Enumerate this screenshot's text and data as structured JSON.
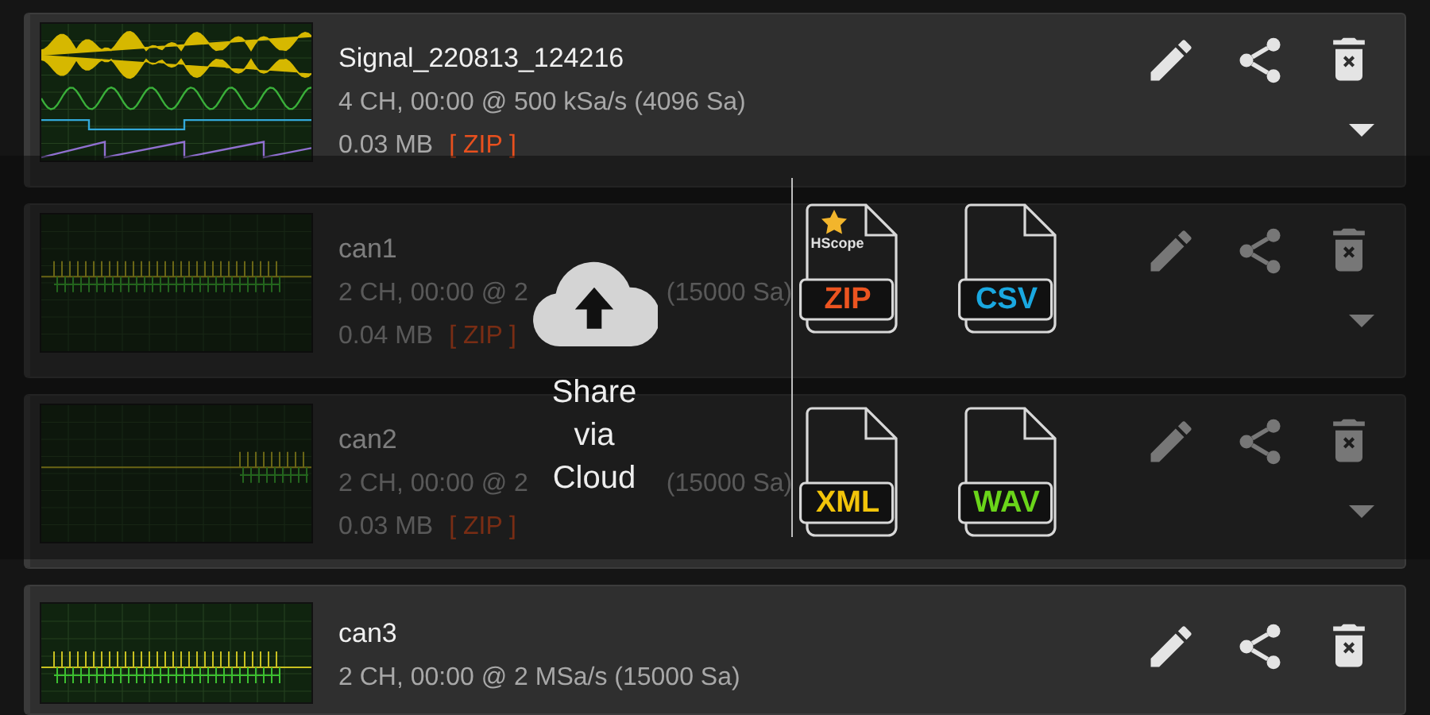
{
  "recordings": [
    {
      "name": "Signal_220813_124216",
      "info": "4 CH, 00:00 @ 500 kSa/s (4096 Sa)",
      "size": "0.03 MB",
      "format": "[ ZIP ]",
      "kind": "analog"
    },
    {
      "name": "can1",
      "info": "2 CH, 00:00 @ 2",
      "info_right": "(15000 Sa)",
      "size": "0.04 MB",
      "format": "[ ZIP ]",
      "kind": "digital"
    },
    {
      "name": "can2",
      "info": "2 CH, 00:00 @ 2",
      "info_right": "(15000 Sa)",
      "size": "0.03 MB",
      "format": "[ ZIP ]",
      "kind": "sparse"
    },
    {
      "name": "can3",
      "info": "2 CH, 00:00 @ 2 MSa/s (15000 Sa)",
      "kind": "digital"
    }
  ],
  "share_menu": {
    "cloud_label": "Share via Cloud",
    "formats": [
      {
        "label": "ZIP",
        "color": "#ec5420",
        "badge": "HScope"
      },
      {
        "label": "CSV",
        "color": "#1aa8e0"
      },
      {
        "label": "XML",
        "color": "#f2c40a"
      },
      {
        "label": "WAV",
        "color": "#6ad51a"
      }
    ]
  }
}
